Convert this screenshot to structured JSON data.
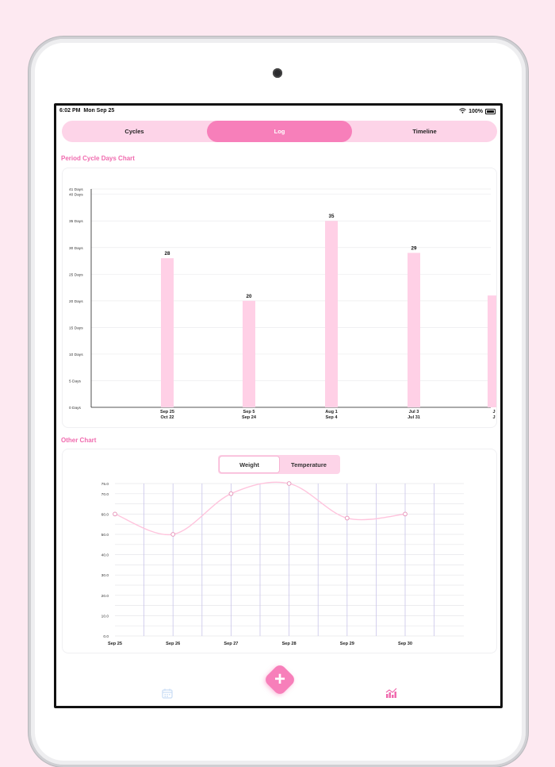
{
  "status_bar": {
    "time": "6:02 PM",
    "date": "Mon Sep 25",
    "battery": "100%",
    "wifi_icon": "wifi-icon",
    "battery_icon": "battery-icon"
  },
  "tabs": [
    {
      "label": "Cycles"
    },
    {
      "label": "Log"
    },
    {
      "label": "Timeline"
    }
  ],
  "active_tab": "Log",
  "colors": {
    "accent": "#f77fba",
    "accent_light": "#fdd4e8",
    "title": "#f06aae",
    "bar": "#ffd0e6",
    "grid_v": "#c9c4ea",
    "line": "#ffc4dd"
  },
  "period_section": {
    "title": "Period Cycle Days Chart"
  },
  "other_section": {
    "title": "Other Chart"
  },
  "metric_toggle": {
    "options": [
      "Weight",
      "Temperature"
    ],
    "selected": "Weight"
  },
  "bottom_nav": {
    "left_icon": "calendar-icon",
    "center_icon": "add-icon",
    "right_icon": "chart-icon",
    "add_label": "+"
  },
  "chart_data": [
    {
      "type": "bar",
      "title": "Period Cycle Days Chart",
      "categories": [
        "Sep 25\nOct 22",
        "Sep 5\nSep 24",
        "Aug 1\nSep 4",
        "Jul 3\nJul 31",
        "J\nJ"
      ],
      "category_lines": [
        [
          "Sep 25",
          "Oct 22"
        ],
        [
          "Sep 5",
          "Sep 24"
        ],
        [
          "Aug 1",
          "Sep 4"
        ],
        [
          "Jul 3",
          "Jul 31"
        ],
        [
          "J",
          "J"
        ]
      ],
      "values": [
        28,
        20,
        35,
        29,
        21
      ],
      "value_labels": [
        "28",
        "20",
        "35",
        "29",
        ""
      ],
      "ylim": [
        0,
        41
      ],
      "yticks": [
        0,
        5,
        10,
        15,
        20,
        25,
        30,
        35,
        40,
        41
      ],
      "ytick_labels": [
        "0 Days",
        "5 Days",
        "10 Days",
        "15 Days",
        "20 Days",
        "25 Days",
        "30 Days",
        "35 Days",
        "40 Days",
        "41 Days"
      ],
      "grid": true
    },
    {
      "type": "line",
      "title": "Other Chart",
      "categories": [
        "Sep 25",
        "Sep 26",
        "Sep 27",
        "Sep 28",
        "Sep 29",
        "Sep 30"
      ],
      "values": [
        60.0,
        50.0,
        70.0,
        75.0,
        58.0,
        60.0
      ],
      "ylim": [
        0,
        75
      ],
      "yticks": [
        0,
        10,
        20,
        30,
        40,
        50,
        60,
        70,
        75
      ],
      "ytick_labels": [
        "0.0",
        "10.0",
        "20.0",
        "30.0",
        "40.0",
        "50.0",
        "60.0",
        "70.0",
        "75.0"
      ],
      "grid": true,
      "smooth": true
    }
  ]
}
